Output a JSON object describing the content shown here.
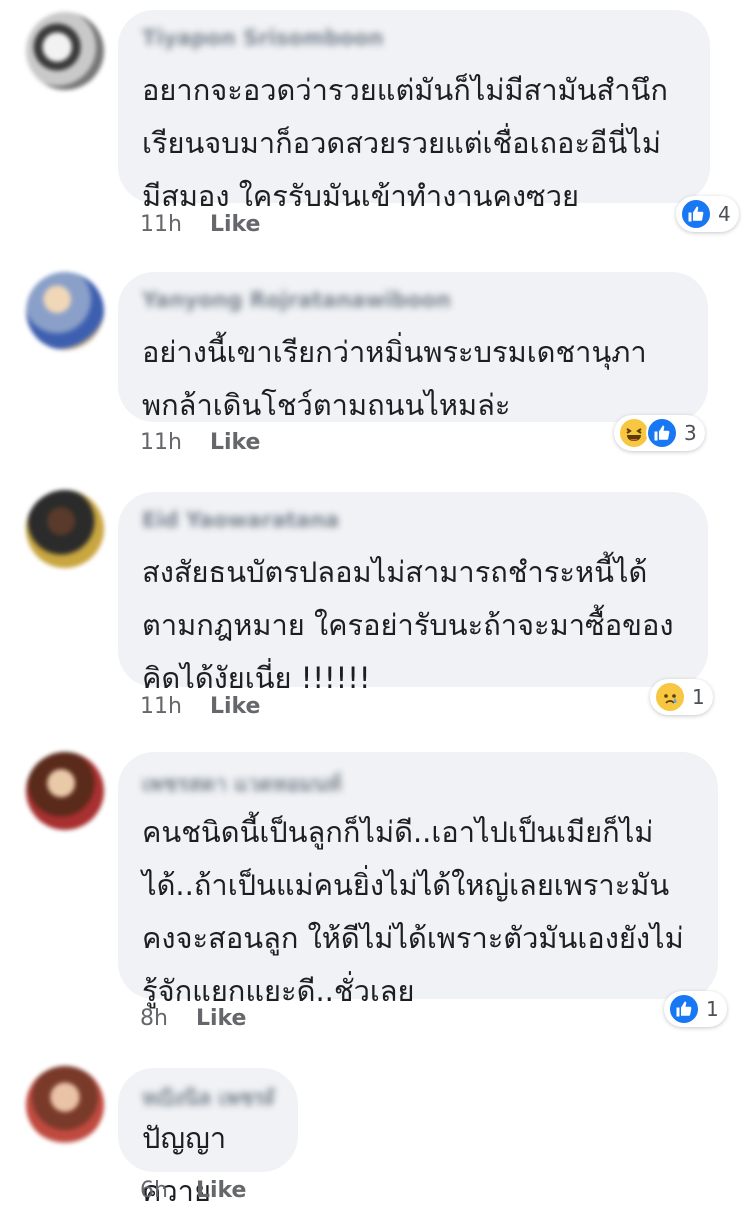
{
  "comments": [
    {
      "author": "Tiyapon Srisomboon",
      "text": "อยากจะอวดว่ารวยแต่มันก็ไม่มีสามันสำนึก\nเรียนจบมาก็อวดสวยรวยแต่เชื่อเถอะอีนี่ไม่\nมีสมอง ใครรับมันเข้าทำงานคงซวย",
      "time": "11h",
      "like_label": "Like",
      "reactions": [
        "like"
      ],
      "reaction_count": "4"
    },
    {
      "author": "Yanyong Rojratanawiboon",
      "text": "อย่างนี้เขาเรียกว่าหมิ่นพระบรมเดชานุภา\nพกล้าเดินโชว์ตามถนนไหมล่ะ",
      "time": "11h",
      "like_label": "Like",
      "reactions": [
        "haha",
        "like"
      ],
      "reaction_count": "3"
    },
    {
      "author": "Eid Yaowaratana",
      "text": "สงสัยธนบัตรปลอมไม่สามารถชำระหนี้ได้\nตามกฎหมาย ใครอย่ารับนะถ้าจะมาซื้อของ\nคิดได้งัยเนี่ย !!!!!!",
      "time": "11h",
      "like_label": "Like",
      "reactions": [
        "sad"
      ],
      "reaction_count": "1"
    },
    {
      "author": "เพชรสุดา แวดหอมนท์",
      "text": "คนชนิดนี้เป็นลูกก็ไม่ดี..เอาไปเป็นเมียก็ไม่\nได้..ถ้าเป็นแม่คนยิ่งไม่ได้ใหญ่เลยเพราะมัน\nคงจะสอนลูก ให้ดีไม่ได้เพราะตัวมันเองยังไม่\nรู้จักแยกแยะดี..ชั่วเลย",
      "time": "8h",
      "like_label": "Like",
      "reactions": [
        "like"
      ],
      "reaction_count": "1"
    },
    {
      "author": "หญิงนิล เพชรดี",
      "text": "ปัญญาควาย",
      "time": "6h",
      "like_label": "Like",
      "reactions": [],
      "reaction_count": ""
    }
  ],
  "colors": {
    "bubble": "#f0f2f5",
    "like_blue": "#1877f2",
    "emoji_yellow": "#f7c742",
    "meta_gray": "#65676b"
  }
}
